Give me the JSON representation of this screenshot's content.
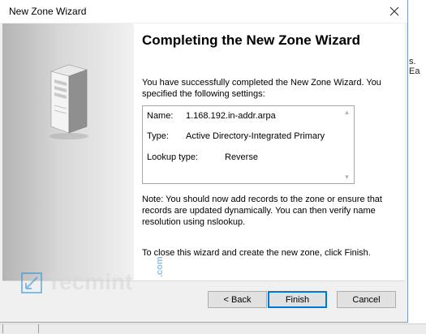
{
  "background": {
    "fragment_right": "s. Ea"
  },
  "wizard": {
    "title": "New Zone Wizard",
    "heading": "Completing the New Zone Wizard",
    "intro_text": "You have successfully completed the New Zone Wizard. You specified the following settings:",
    "settings": [
      {
        "label": "Name:",
        "value": "1.168.192.in-addr.arpa"
      },
      {
        "label": "Type:",
        "value": "Active Directory-Integrated Primary"
      },
      {
        "label": "Lookup type:",
        "value": "Reverse"
      }
    ],
    "note_text": "Note: You should now add records to the zone or ensure that records are updated dynamically. You can then verify name resolution using nslookup.",
    "close_text": "To close this wizard and create the new zone, click Finish.",
    "buttons": {
      "back": "< Back",
      "finish": "Finish",
      "cancel": "Cancel"
    }
  },
  "watermark": {
    "text": "Tecmint",
    "suffix": ".com"
  },
  "colors": {
    "accent": "#0078d7",
    "panel_bg": "#f0f0f0",
    "watermark": "#2a8fd6"
  },
  "icons": [
    "close-icon",
    "server-icon",
    "scroll-up-icon",
    "scroll-down-icon",
    "tecmint-logo-icon"
  ]
}
